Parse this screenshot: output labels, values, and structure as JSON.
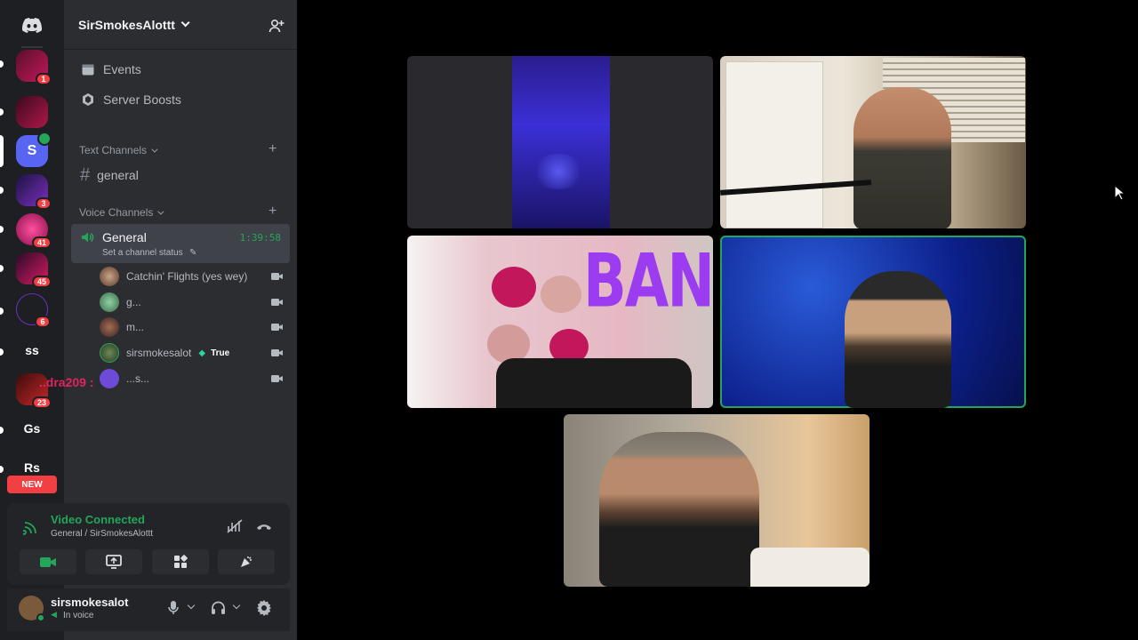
{
  "server": {
    "name": "SirSmokesAlottt",
    "items": [
      {
        "label": "Events"
      },
      {
        "label": "Server Boosts"
      }
    ]
  },
  "rail": {
    "servers": [
      {
        "initials": "",
        "badge": "1"
      },
      {
        "initials": "",
        "badge": ""
      },
      {
        "initials": "S",
        "badge": ""
      },
      {
        "initials": "",
        "badge": "3"
      },
      {
        "initials": "",
        "badge": "41"
      },
      {
        "initials": "",
        "badge": "45"
      },
      {
        "initials": "",
        "badge": "6"
      },
      {
        "initials": "ss",
        "badge": ""
      },
      {
        "initials": "",
        "badge": "23"
      },
      {
        "initials": "Gs",
        "badge": ""
      },
      {
        "initials": "Rs",
        "badge": ""
      }
    ],
    "new_label": "NEW"
  },
  "text_channels": {
    "category": "Text Channels",
    "channels": [
      {
        "name": "general"
      }
    ]
  },
  "voice_channels": {
    "category": "Voice Channels",
    "active": {
      "name": "General",
      "status": "Set a channel status",
      "timer": "1:39:58"
    },
    "users": [
      {
        "name": "Catchin' Flights (yes wey)",
        "tag": ""
      },
      {
        "name": "g...",
        "tag": ""
      },
      {
        "name": "m...",
        "tag": ""
      },
      {
        "name": "sirsmokesalot",
        "tag": "True"
      },
      {
        "name": "...s...",
        "tag": ""
      }
    ],
    "overlay_name": "..dra209 :"
  },
  "voice_panel": {
    "title": "Video Connected",
    "subtitle": "General / SirSmokesAlottt"
  },
  "user_panel": {
    "username": "sirsmokesalot",
    "status": "In voice"
  },
  "stage": {
    "tiles": [
      {
        "overlay_text": ""
      },
      {
        "overlay_text": ""
      },
      {
        "overlay_text": "BANG"
      },
      {
        "overlay_text": ""
      },
      {
        "overlay_text": ""
      }
    ]
  },
  "colors": {
    "accent_green": "#23a55a",
    "badge_red": "#f23f43",
    "sidebar": "#2b2d31",
    "rail": "#1e1f22"
  }
}
